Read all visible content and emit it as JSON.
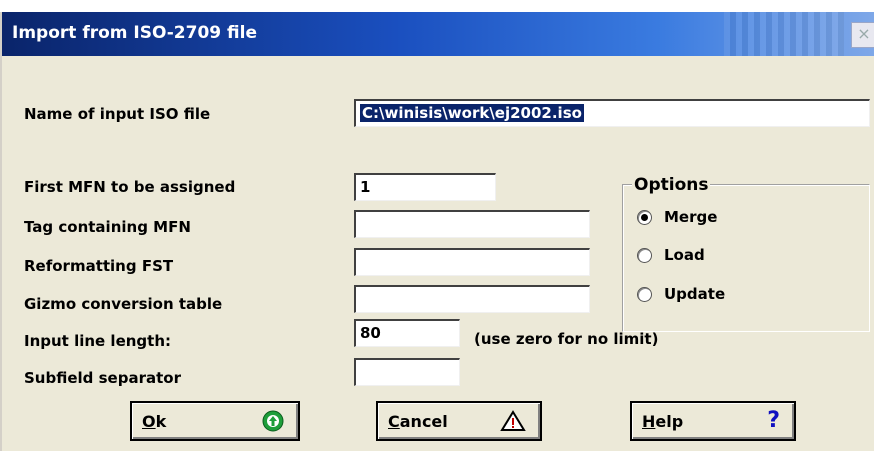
{
  "window": {
    "title": "Import from ISO-2709 file",
    "close_glyph": "×"
  },
  "fields": {
    "input_iso_file": {
      "label": "Name of input ISO file",
      "value": "C:\\winisis\\work\\ej2002.iso"
    },
    "first_mfn": {
      "label": "First MFN to be assigned",
      "value": "1"
    },
    "tag_mfn": {
      "label": "Tag containing MFN",
      "value": ""
    },
    "reformatting_fst": {
      "label": "Reformatting FST",
      "value": ""
    },
    "gizmo_table": {
      "label": "Gizmo conversion table",
      "value": ""
    },
    "line_length": {
      "label": "Input line length:",
      "value": "80",
      "hint": "(use zero for no limit)"
    },
    "subfield_separator": {
      "label": "Subfield separator",
      "value": ""
    }
  },
  "options": {
    "title": "Options",
    "items": [
      {
        "label": "Merge",
        "checked": true
      },
      {
        "label": "Load",
        "checked": false
      },
      {
        "label": "Update",
        "checked": false
      }
    ]
  },
  "buttons": {
    "ok": {
      "accel": "O",
      "rest": "k",
      "icon": "green-arrow-up-icon"
    },
    "cancel": {
      "accel": "C",
      "rest": "ancel",
      "icon": "warning-triangle-icon"
    },
    "help": {
      "accel": "H",
      "rest": "elp",
      "icon": "question-mark-icon",
      "glyph": "?"
    }
  },
  "colors": {
    "title_start": "#0a246a",
    "title_end": "#7fa8e8",
    "dialog_bg": "#ece9d8",
    "selection": "#0a246a",
    "ok_icon": "#1e9e3a",
    "warning": "#000000",
    "help_icon": "#1010c0"
  }
}
